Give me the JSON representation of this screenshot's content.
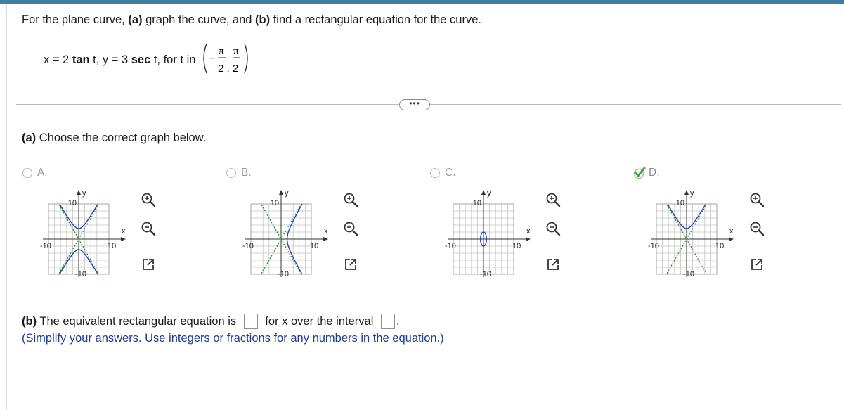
{
  "prompt": {
    "pre": "For the plane curve, ",
    "a_label": "(a)",
    "a_text": " graph the curve, and ",
    "b_label": "(b)",
    "b_text": " find a rectangular equation for the curve."
  },
  "parametric": {
    "x_lhs": "x = 2 ",
    "x_fn": "tan",
    "x_rest": " t, y = 3 ",
    "y_fn": "sec",
    "y_rest": " t, for t in",
    "interval_minus": "−",
    "interval_pi1": "π",
    "interval_pi2": "π",
    "interval_den": "2 , 2"
  },
  "ellipsis_label": "•••",
  "part_a": {
    "label": "(a)",
    "text": " Choose the correct graph below."
  },
  "choices": [
    {
      "letter": "A.",
      "selected": false
    },
    {
      "letter": "B.",
      "selected": false
    },
    {
      "letter": "C.",
      "selected": false
    },
    {
      "letter": "D.",
      "selected": true
    }
  ],
  "graph_labels": {
    "y_axis": "y",
    "x_axis": "x",
    "tick_pos": "10",
    "tick_neg": "-10",
    "y_top": "10",
    "y_bottom": "-10"
  },
  "tools": {
    "zoom_in": "zoom-in-icon",
    "zoom_out": "zoom-out-icon",
    "popout": "popout-icon"
  },
  "part_b": {
    "label": "(b)",
    "text1": " The equivalent rectangular equation is ",
    "text2": " for x over the interval ",
    "end": "."
  },
  "hint": "(Simplify your answers. Use integers or fractions for any numbers in the equation.)",
  "colors": {
    "accent": "#3e7ea1",
    "curve": "#1f3fbf",
    "asymptote": "#2e9a2e",
    "check": "#3aa935",
    "hint": "#1e3d8f"
  }
}
